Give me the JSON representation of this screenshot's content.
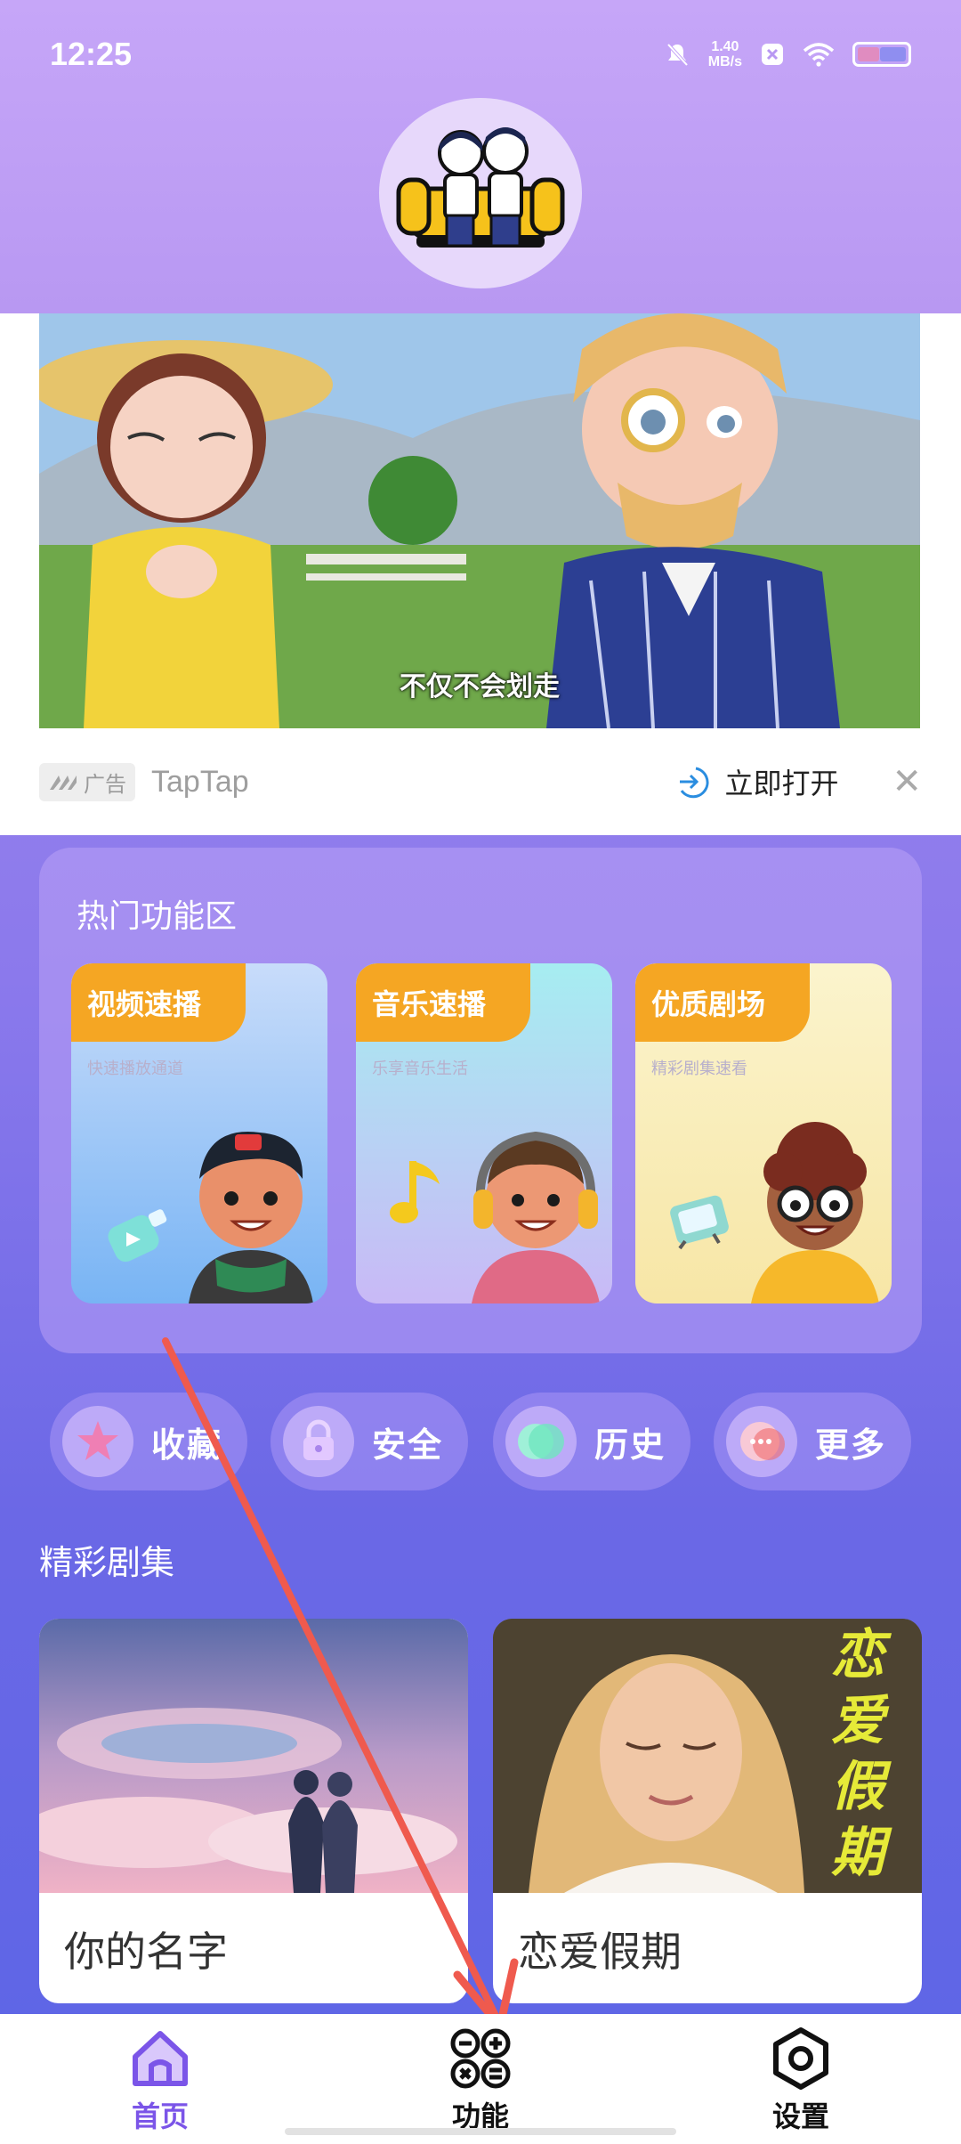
{
  "status_bar": {
    "time": "12:25",
    "net_speed_value": "1.40",
    "net_speed_unit": "MB/s",
    "icons": [
      "mute-icon",
      "app-notification-icon",
      "wifi-icon",
      "battery-icon"
    ]
  },
  "header": {
    "logo_icon": "couple-sofa-logo"
  },
  "ad": {
    "caption": "不仅不会划走",
    "badge": "广告",
    "brand": "TapTap",
    "open_label": "立即打开",
    "close_icon": "close-icon"
  },
  "hot_features": {
    "title": "热门功能区",
    "cards": [
      {
        "label": "视频速播",
        "subtitle": "快速播放通道",
        "colors": [
          "#c7dcfa",
          "#7db8f5"
        ],
        "prop_icon": "play-bottle-icon"
      },
      {
        "label": "音乐速播",
        "subtitle": "乐享音乐生活",
        "colors": [
          "#a8eef2",
          "#cbb9f6"
        ],
        "prop_icon": "music-note-icon"
      },
      {
        "label": "优质剧场",
        "subtitle": "精彩剧集速看",
        "colors": [
          "#fbf3c8",
          "#f6e6a5"
        ],
        "prop_icon": "tv-icon"
      }
    ]
  },
  "quick_actions": [
    {
      "label": "收藏",
      "icon": "star-icon"
    },
    {
      "label": "安全",
      "icon": "lock-icon"
    },
    {
      "label": "历史",
      "icon": "history-icon"
    },
    {
      "label": "更多",
      "icon": "more-icon"
    }
  ],
  "featured": {
    "title": "精彩剧集",
    "shows": [
      {
        "title": "你的名字",
        "poster_text": ""
      },
      {
        "title": "恋爱假期",
        "poster_text": "恋爱假期"
      }
    ]
  },
  "bottom_nav": {
    "items": [
      {
        "label": "首页",
        "icon": "home-icon",
        "active": true
      },
      {
        "label": "功能",
        "icon": "functions-icon",
        "active": false
      },
      {
        "label": "设置",
        "icon": "settings-icon",
        "active": false
      }
    ]
  },
  "colors": {
    "accent": "#7b55e8",
    "tag": "#f5a623",
    "arrow": "#ef5a4e"
  }
}
